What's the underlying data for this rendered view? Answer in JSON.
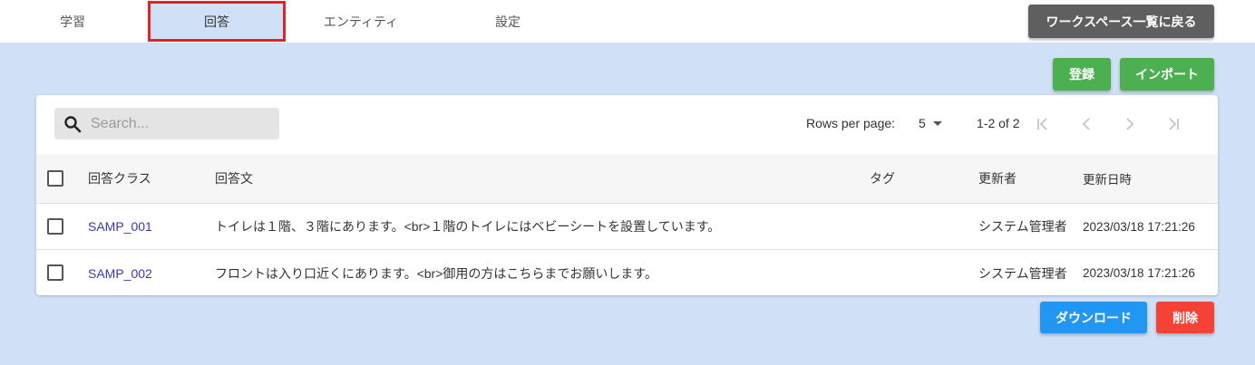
{
  "tabs": [
    {
      "label": "学習"
    },
    {
      "label": "回答"
    },
    {
      "label": "エンティティ"
    },
    {
      "label": "設定"
    }
  ],
  "active_tab": "回答",
  "back_button": "ワークスペース一覧に戻る",
  "actions": {
    "register": "登録",
    "import": "インポート",
    "download": "ダウンロード",
    "delete": "削除"
  },
  "search": {
    "placeholder": "Search...",
    "value": ""
  },
  "pagination": {
    "rows_per_page_label": "Rows per page:",
    "rows_per_page": "5",
    "range": "1-2 of 2"
  },
  "table": {
    "columns": {
      "class": "回答クラス",
      "text": "回答文",
      "tag": "タグ",
      "updated_by": "更新者",
      "updated_at": "更新日時"
    },
    "rows": [
      {
        "class": "SAMP_001",
        "text": "トイレは１階、３階にあります。<br>１階のトイレにはベビーシートを設置しています。",
        "tag": "",
        "updated_by": "システム管理者",
        "updated_at": "2023/03/18 17:21:26"
      },
      {
        "class": "SAMP_002",
        "text": "フロントは入り口近くにあります。<br>御用の方はこちらまでお願いします。",
        "tag": "",
        "updated_by": "システム管理者",
        "updated_at": "2023/03/18 17:21:26"
      }
    ]
  },
  "colors": {
    "background": "#d0e0f6",
    "active_tab_border": "#e32222",
    "green": "#4caf50",
    "blue": "#2196f3",
    "red": "#f44336",
    "dark": "#5f5f5f",
    "link": "#3a3aa8"
  },
  "icons": {
    "search": "search-icon",
    "caret": "caret-down-icon",
    "first": "first-page-icon",
    "prev": "chevron-left-icon",
    "next": "chevron-right-icon",
    "last": "last-page-icon"
  }
}
